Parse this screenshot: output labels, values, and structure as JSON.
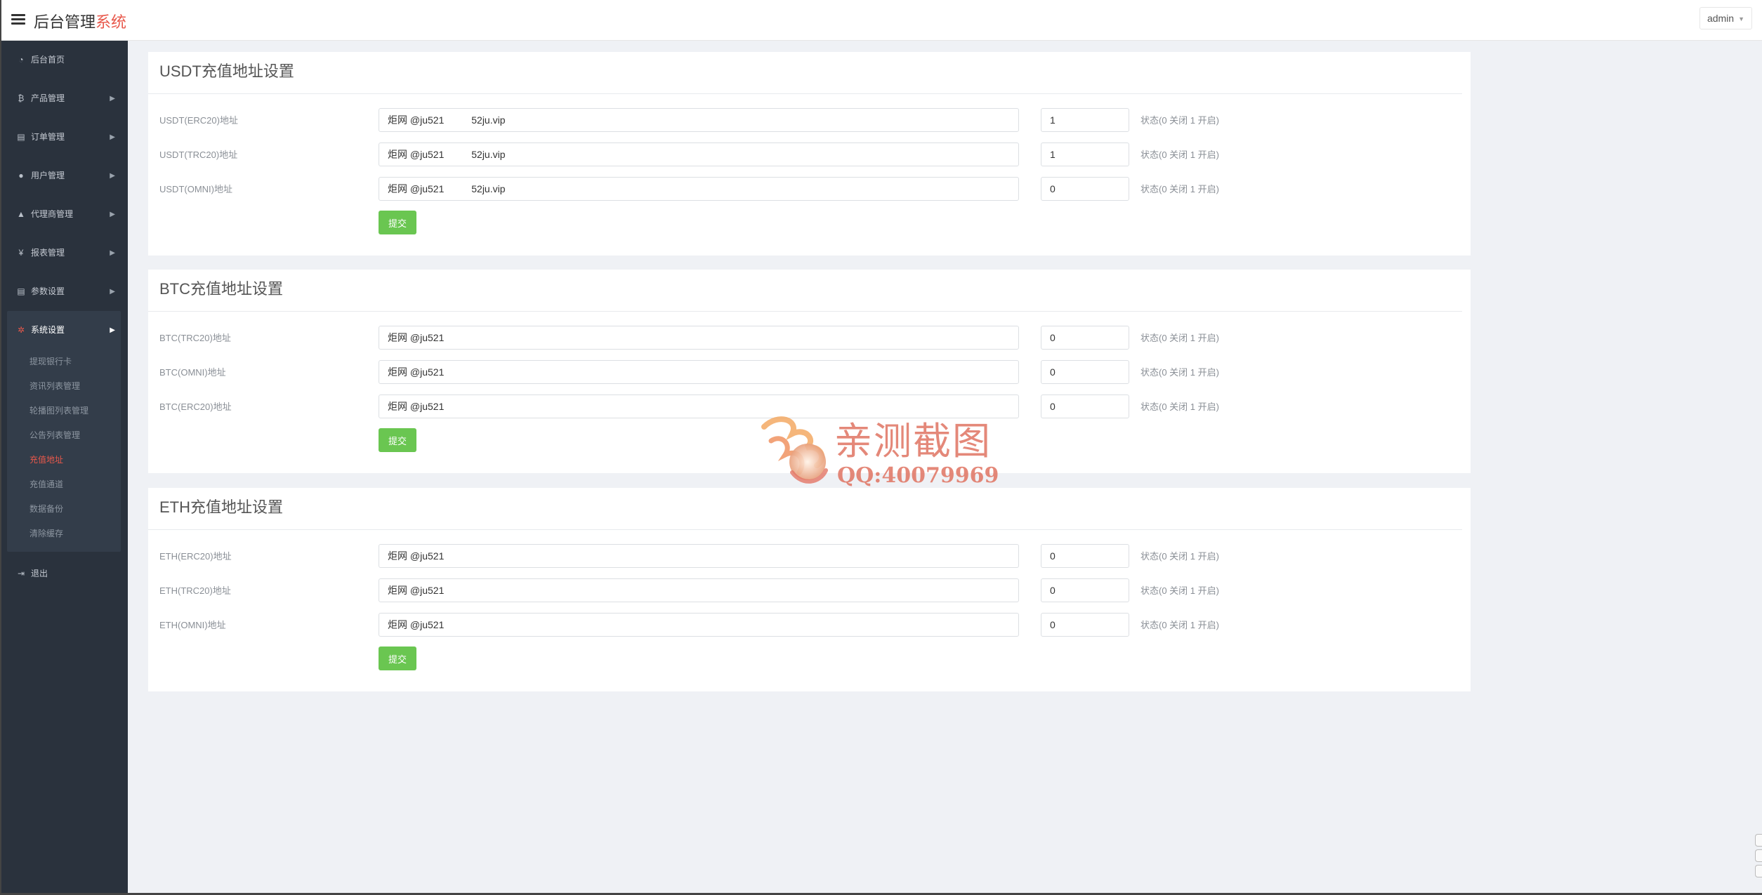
{
  "header": {
    "brand_main": "后台管理",
    "brand_accent": "系统",
    "user": "admin"
  },
  "sidebar": {
    "items": [
      {
        "icon": "dashboard-icon",
        "glyph": "◔",
        "label": "后台首页",
        "has_arrow": false
      },
      {
        "icon": "bitcoin-icon",
        "glyph": "₿",
        "label": "产品管理",
        "has_arrow": true
      },
      {
        "icon": "clipboard-icon",
        "glyph": "▤",
        "label": "订单管理",
        "has_arrow": true
      },
      {
        "icon": "user-icon",
        "glyph": "●",
        "label": "用户管理",
        "has_arrow": true
      },
      {
        "icon": "agent-icon",
        "glyph": "▲",
        "label": "代理商管理",
        "has_arrow": true
      },
      {
        "icon": "yen-icon",
        "glyph": "¥",
        "label": "报表管理",
        "has_arrow": true
      },
      {
        "icon": "copy-icon",
        "glyph": "▤",
        "label": "参数设置",
        "has_arrow": true
      }
    ],
    "active_group": {
      "icon": "gears-icon",
      "glyph": "✲",
      "label": "系统设置",
      "sub_items": [
        {
          "label": "提现银行卡",
          "active": false
        },
        {
          "label": "资讯列表管理",
          "active": false
        },
        {
          "label": "轮播图列表管理",
          "active": false
        },
        {
          "label": "公告列表管理",
          "active": false
        },
        {
          "label": "充值地址",
          "active": true
        },
        {
          "label": "充值通道",
          "active": false
        },
        {
          "label": "数据备份",
          "active": false
        },
        {
          "label": "清除缓存",
          "active": false
        }
      ]
    },
    "logout": {
      "icon": "signout-icon",
      "glyph": "⇥",
      "label": "退出"
    }
  },
  "sections": [
    {
      "title": "USDT充值地址设置",
      "rows": [
        {
          "label": "USDT(ERC20)地址",
          "address": "炬网 @ju521          52ju.vip",
          "status": "1",
          "hint": "状态(0 关闭 1 开启)"
        },
        {
          "label": "USDT(TRC20)地址",
          "address": "炬网 @ju521          52ju.vip",
          "status": "1",
          "hint": "状态(0 关闭 1 开启)"
        },
        {
          "label": "USDT(OMNI)地址",
          "address": "炬网 @ju521          52ju.vip",
          "status": "0",
          "hint": "状态(0 关闭 1 开启)"
        }
      ],
      "submit": "提交"
    },
    {
      "title": "BTC充值地址设置",
      "rows": [
        {
          "label": "BTC(TRC20)地址",
          "address": "炬网 @ju521",
          "status": "0",
          "hint": "状态(0 关闭 1 开启)"
        },
        {
          "label": "BTC(OMNI)地址",
          "address": "炬网 @ju521",
          "status": "0",
          "hint": "状态(0 关闭 1 开启)"
        },
        {
          "label": "BTC(ERC20)地址",
          "address": "炬网 @ju521",
          "status": "0",
          "hint": "状态(0 关闭 1 开启)"
        }
      ],
      "submit": "提交"
    },
    {
      "title": "ETH充值地址设置",
      "rows": [
        {
          "label": "ETH(ERC20)地址",
          "address": "炬网 @ju521",
          "status": "0",
          "hint": "状态(0 关闭 1 开启)"
        },
        {
          "label": "ETH(TRC20)地址",
          "address": "炬网 @ju521",
          "status": "0",
          "hint": "状态(0 关闭 1 开启)"
        },
        {
          "label": "ETH(OMNI)地址",
          "address": "炬网 @ju521",
          "status": "0",
          "hint": "状态(0 关闭 1 开启)"
        }
      ],
      "submit": "提交"
    }
  ],
  "watermark": {
    "line1": "亲测截图",
    "line2": "QQ:40079969"
  },
  "colors": {
    "accent": "#e8584b",
    "submit": "#6ac651",
    "sidebar": "#2a323d"
  }
}
